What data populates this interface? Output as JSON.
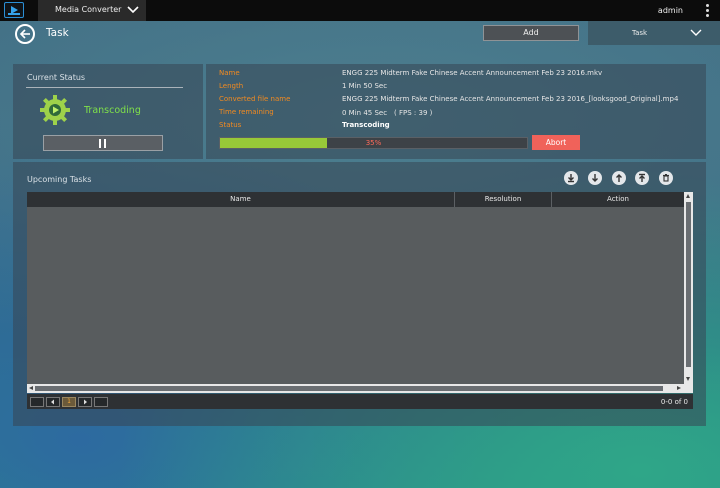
{
  "topbar": {
    "app_tab_label": "Media Converter",
    "user_label": "admin"
  },
  "header": {
    "title": "Task",
    "add_label": "Add",
    "task_dropdown_label": "Task"
  },
  "current_status": {
    "heading": "Current Status",
    "state_label": "Transcoding"
  },
  "details": {
    "name_key": "Name",
    "name_value": "ENGG 225 Midterm Fake Chinese Accent Announcement Feb 23 2016.mkv",
    "length_key": "Length",
    "length_value": "1 Min 50 Sec",
    "converted_key": "Converted file name",
    "converted_value": "ENGG 225 Midterm Fake Chinese Accent Announcement Feb 23 2016_[looksgood_Original].mp4",
    "remaining_key": "Time remaining",
    "remaining_value": "0 Min 45 Sec　( FPS : 39 )",
    "status_key": "Status",
    "status_value": "Transcoding",
    "progress_percent": 35,
    "progress_label": "35%",
    "abort_label": "Abort"
  },
  "upcoming": {
    "heading": "Upcoming Tasks",
    "toolbar_icons": [
      "move-bottom-icon",
      "move-down-icon",
      "move-up-icon",
      "move-top-icon",
      "trash-icon"
    ],
    "columns": [
      "Name",
      "Resolution",
      "Action"
    ],
    "rows": [],
    "pager": {
      "current_page": "1",
      "summary": "0-0 of 0"
    }
  },
  "colors": {
    "accent_orange": "#f08a21",
    "progress_green": "#98c938",
    "abort_red": "#f0625a",
    "status_green": "#7fe04a"
  }
}
